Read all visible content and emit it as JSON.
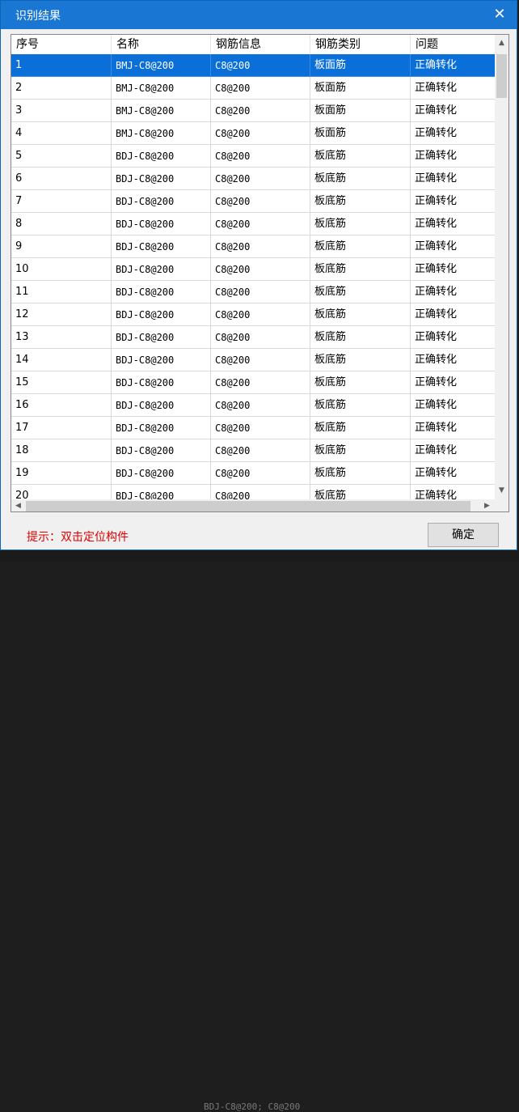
{
  "dialog": {
    "title": "识别结果",
    "close_icon": "close-icon",
    "hint": "提示：双击定位构件",
    "ok_label": "确定"
  },
  "table": {
    "columns": [
      "序号",
      "名称",
      "钢筋信息",
      "钢筋类别",
      "问题"
    ],
    "rows": [
      [
        "1",
        "BMJ-C8@200",
        "C8@200",
        "板面筋",
        "正确转化"
      ],
      [
        "2",
        "BMJ-C8@200",
        "C8@200",
        "板面筋",
        "正确转化"
      ],
      [
        "3",
        "BMJ-C8@200",
        "C8@200",
        "板面筋",
        "正确转化"
      ],
      [
        "4",
        "BMJ-C8@200",
        "C8@200",
        "板面筋",
        "正确转化"
      ],
      [
        "5",
        "BDJ-C8@200",
        "C8@200",
        "板底筋",
        "正确转化"
      ],
      [
        "6",
        "BDJ-C8@200",
        "C8@200",
        "板底筋",
        "正确转化"
      ],
      [
        "7",
        "BDJ-C8@200",
        "C8@200",
        "板底筋",
        "正确转化"
      ],
      [
        "8",
        "BDJ-C8@200",
        "C8@200",
        "板底筋",
        "正确转化"
      ],
      [
        "9",
        "BDJ-C8@200",
        "C8@200",
        "板底筋",
        "正确转化"
      ],
      [
        "10",
        "BDJ-C8@200",
        "C8@200",
        "板底筋",
        "正确转化"
      ],
      [
        "11",
        "BDJ-C8@200",
        "C8@200",
        "板底筋",
        "正确转化"
      ],
      [
        "12",
        "BDJ-C8@200",
        "C8@200",
        "板底筋",
        "正确转化"
      ],
      [
        "13",
        "BDJ-C8@200",
        "C8@200",
        "板底筋",
        "正确转化"
      ],
      [
        "14",
        "BDJ-C8@200",
        "C8@200",
        "板底筋",
        "正确转化"
      ],
      [
        "15",
        "BDJ-C8@200",
        "C8@200",
        "板底筋",
        "正确转化"
      ],
      [
        "16",
        "BDJ-C8@200",
        "C8@200",
        "板底筋",
        "正确转化"
      ],
      [
        "17",
        "BDJ-C8@200",
        "C8@200",
        "板底筋",
        "正确转化"
      ],
      [
        "18",
        "BDJ-C8@200",
        "C8@200",
        "板底筋",
        "正确转化"
      ],
      [
        "19",
        "BDJ-C8@200",
        "C8@200",
        "板底筋",
        "正确转化"
      ],
      [
        "20",
        "BDJ-C8@200",
        "C8@200",
        "板底筋",
        "正确转化"
      ]
    ],
    "selected_row": 1
  },
  "background": {
    "status_text": "BDJ-C8@200; C8@200"
  },
  "colors": {
    "titlebar": "#1976d2",
    "selection": "#0a6fd8",
    "hint": "#e00000"
  }
}
